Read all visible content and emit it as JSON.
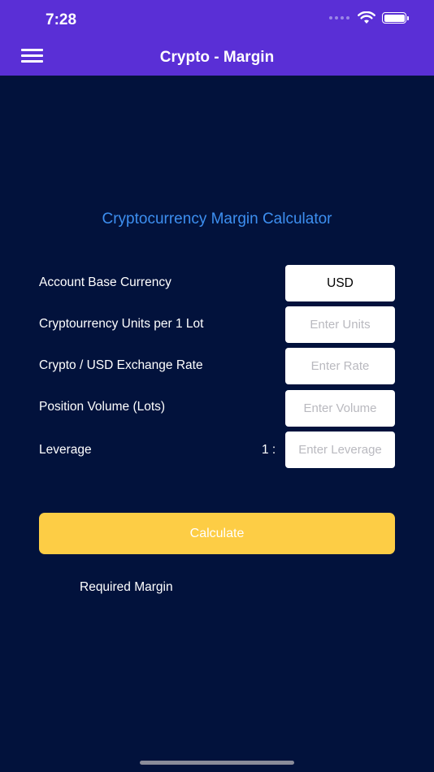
{
  "status_bar": {
    "time": "7:28"
  },
  "nav": {
    "title": "Crypto - Margin",
    "menu_icon": "hamburger-menu-icon"
  },
  "calculator": {
    "title": "Cryptocurrency Margin Calculator",
    "rows": [
      {
        "label": "Account Base Currency",
        "value": "USD"
      },
      {
        "label": "Cryptourrency Units per 1 Lot",
        "placeholder": "Enter Units"
      },
      {
        "label": "Crypto / USD Exchange Rate",
        "placeholder": "Enter Rate"
      },
      {
        "label": "Position Volume (Lots)",
        "placeholder": "Enter Volume"
      },
      {
        "label": "Leverage",
        "prefix": "1 :",
        "placeholder": "Enter Leverage"
      }
    ],
    "button_label": "Calculate",
    "result_label": "Required Margin"
  },
  "colors": {
    "background": "#02123c",
    "header": "#5a2fd6",
    "title_accent": "#3d8ff0",
    "button": "#fdcd45"
  }
}
